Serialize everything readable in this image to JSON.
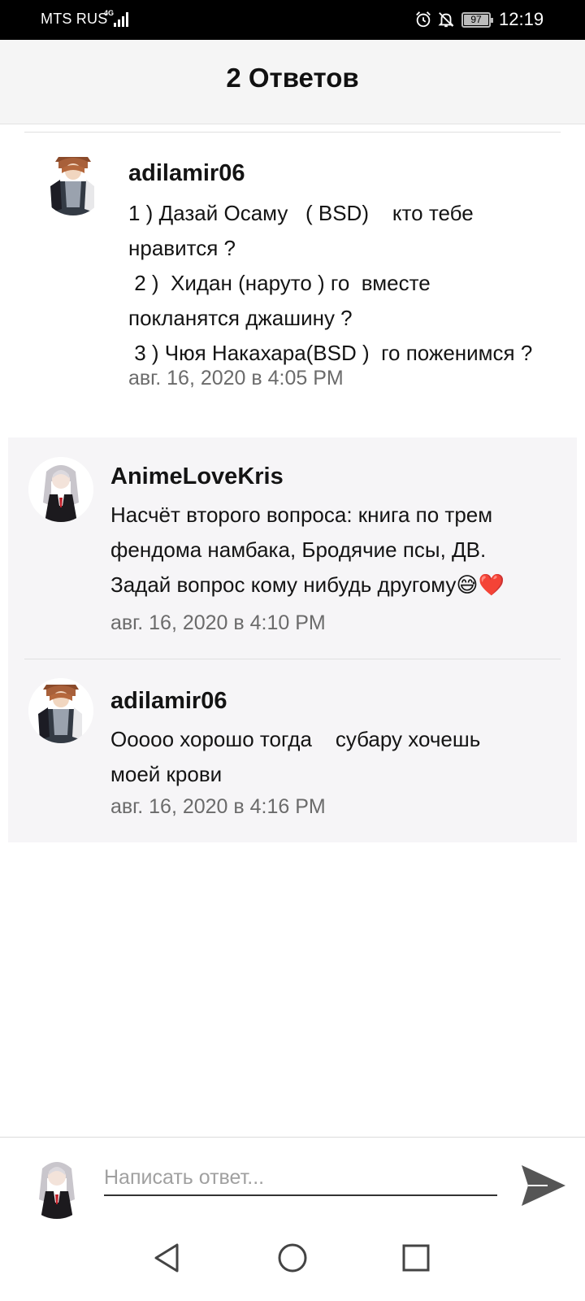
{
  "status_bar": {
    "carrier": "MTS RUS",
    "network": "4G",
    "battery": "97",
    "time": "12:19",
    "icons": [
      "signal-icon",
      "alarm-icon",
      "bell-off-icon",
      "battery-icon"
    ]
  },
  "header": {
    "title": "2 Ответов"
  },
  "comments": [
    {
      "user": "adilamir06",
      "text": "1 ) Дазай Осаму   ( BSD)    кто тебе\nнравится ?\n 2 )  Хидан (наруто ) го  вместе\nпокланятся джашину ?\n 3 ) Чюя Накахара(BSD )  го поженимся ?",
      "time": "авг. 16, 2020 в 4:05 PM"
    },
    {
      "user": "AnimeLoveKris",
      "text": "Насчёт второго вопроса: книга по трем\nфендома намбака, Бродячие псы, ДВ.\nЗадай вопрос кому нибудь другому😅❤️",
      "time": "авг. 16, 2020 в 4:10 PM"
    },
    {
      "user": "adilamir06",
      "text": "Ооооо хорошо тогда    субару хочешь\nмоей крови",
      "time": "авг. 16, 2020 в 4:16 PM"
    }
  ],
  "composer": {
    "placeholder": "Написать ответ...",
    "icons": [
      "avatar",
      "send-icon"
    ]
  },
  "nav_bar": {
    "icons": [
      "back-icon",
      "home-icon",
      "recents-icon"
    ]
  },
  "colors": {
    "header_bg": "#f5f5f5",
    "reply_bg": "#f6f5f7",
    "timestamp": "#6b6b6b",
    "send": "#555555"
  }
}
